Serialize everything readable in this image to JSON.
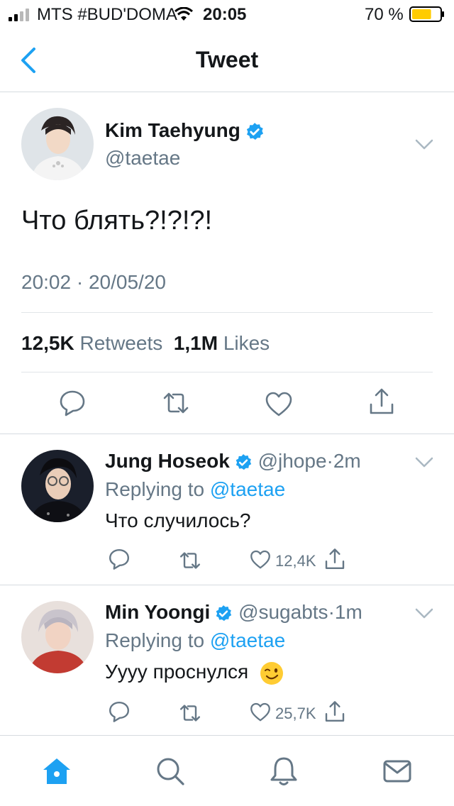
{
  "status_bar": {
    "carrier": "MTS #BUD'DOMA",
    "time": "20:05",
    "battery_percent": "70 %",
    "battery_level": 0.7,
    "battery_color": "#ffcc00"
  },
  "header": {
    "title": "Tweet",
    "back_icon": "chevron-left-icon"
  },
  "tweet": {
    "author_name": "Kim Taehyung",
    "verified": true,
    "handle": "@taetae",
    "text": "Что блять?!?!?!",
    "time": "20:02",
    "date": "20/05/20",
    "meta_separator": "·",
    "retweets_count": "12,5K",
    "retweets_label": "Retweets",
    "likes_count": "1,1M",
    "likes_label": "Likes",
    "actions": [
      "reply-icon",
      "retweet-icon",
      "like-icon",
      "share-icon"
    ]
  },
  "replies": [
    {
      "name": "Jung Hoseok",
      "verified": true,
      "handle": "@jhope",
      "time": "2m",
      "replying_prefix": "Replying to",
      "replying_to": "@taetae",
      "text": "Что случилось?",
      "like_count": "12,4K"
    },
    {
      "name": "Min Yoongi",
      "verified": true,
      "handle": "@sugabts",
      "time": "1m",
      "replying_prefix": "Replying to",
      "replying_to": "@taetae",
      "text": "Уууу проснулся",
      "emoji": "winking-face-icon",
      "like_count": "25,7K"
    }
  ],
  "tab_bar": {
    "tabs": [
      "home-icon",
      "search-icon",
      "notifications-icon",
      "messages-icon"
    ],
    "active": "home-icon"
  },
  "colors": {
    "accent": "#1da1f2",
    "secondary_text": "#657786",
    "divider": "#d6dbe0"
  }
}
